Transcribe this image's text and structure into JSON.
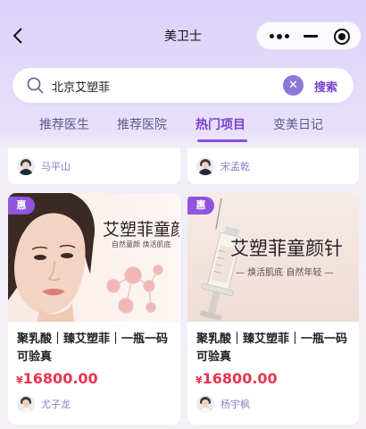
{
  "nav": {
    "title": "美卫士"
  },
  "search": {
    "value": "北京艾塑菲",
    "button_label": "搜索"
  },
  "tabs": [
    {
      "label": "推荐医生",
      "active": false
    },
    {
      "label": "推荐医院",
      "active": false
    },
    {
      "label": "热门项目",
      "active": true
    },
    {
      "label": "变美日记",
      "active": false
    }
  ],
  "top_cards": [
    {
      "doctor": "马平山"
    },
    {
      "doctor": "宋孟乾"
    }
  ],
  "products": [
    {
      "badge": "惠",
      "image_heading": "艾塑菲童颜",
      "image_sub": "自然童颜 焕活肌底",
      "title": "聚乳酸｜臻艾塑菲｜一瓶一码可验真",
      "currency": "¥",
      "price": "16800.00",
      "doctor": "尤子龙"
    },
    {
      "badge": "惠",
      "image_heading": "艾塑菲童颜针",
      "image_sub": "— 焕活肌底 自然年轻 —",
      "title": "聚乳酸｜臻艾塑菲｜一瓶一码可验真",
      "currency": "¥",
      "price": "16800.00",
      "doctor": "杨宇枫"
    }
  ],
  "colors": {
    "accent": "#7a3fd0",
    "price": "#e8354f",
    "badge": "#8f55dd"
  }
}
